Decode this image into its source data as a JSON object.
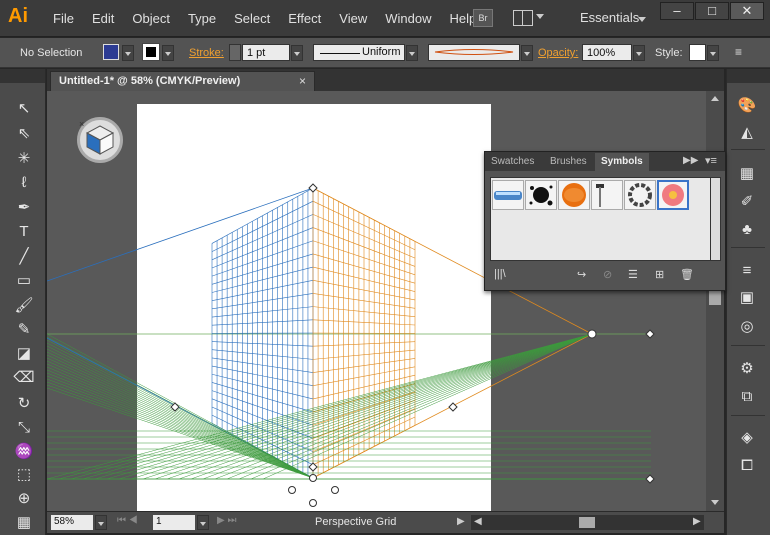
{
  "app": {
    "logo": "Ai"
  },
  "menu": [
    "File",
    "Edit",
    "Object",
    "Type",
    "Select",
    "Effect",
    "View",
    "Window",
    "Help"
  ],
  "bridge_label": "Br",
  "workspace": "Essentials",
  "window_controls": [
    "–",
    "□",
    "✕"
  ],
  "control_bar": {
    "selection": "No Selection",
    "stroke_label": "Stroke:",
    "stroke_weight": "1 pt",
    "profile": "Uniform",
    "opacity_label": "Opacity:",
    "opacity": "100%",
    "style_label": "Style:"
  },
  "document": {
    "tab_title": "Untitled-1* @ 58% (CMYK/Preview)",
    "close": "×"
  },
  "status": {
    "zoom": "58%",
    "page": "1",
    "tool": "Perspective Grid"
  },
  "panel": {
    "tabs": [
      "Swatches",
      "Brushes",
      "Symbols"
    ],
    "active_tab": "Symbols",
    "symbols": [
      "blue-glossy-bar",
      "black-splatter",
      "orange-ball",
      "hammer",
      "chain-ring",
      "pink-flower"
    ]
  },
  "colors": {
    "fill": "#2c3b93",
    "grid_left": "#2a6fbd",
    "grid_right": "#e08a1e",
    "grid_ground": "#3d9a3d",
    "horizon": "#6fae5e",
    "accent": "#ff9a00"
  }
}
